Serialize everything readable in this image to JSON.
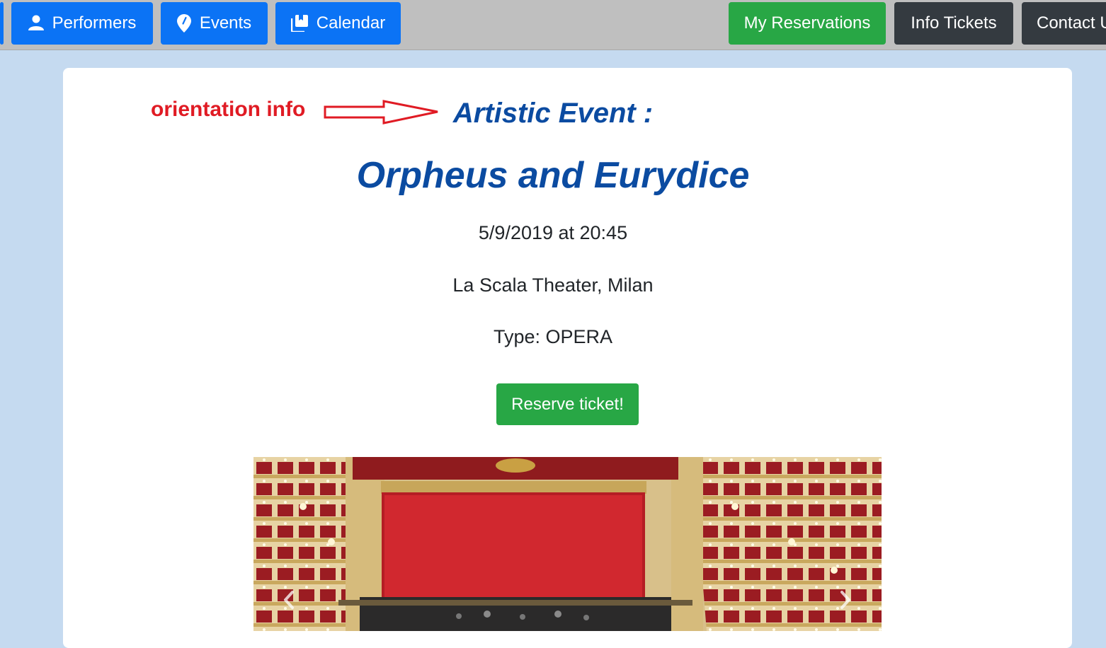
{
  "nav": {
    "left": [
      {
        "label": "Performers",
        "icon": "person-icon"
      },
      {
        "label": "Events",
        "icon": "map-pin-icon"
      },
      {
        "label": "Calendar",
        "icon": "collection-icon"
      }
    ],
    "right": [
      {
        "label": "My Reservations"
      },
      {
        "label": "Info Tickets"
      },
      {
        "label": "Contact Us"
      }
    ]
  },
  "annotation": {
    "label": "orientation info",
    "color": "#e01b24",
    "arrow_icon": "right-arrow-icon"
  },
  "event": {
    "subtitle": "Artistic Event :",
    "title": "Orpheus and Eurydice",
    "datetime": "5/9/2019 at 20:45",
    "venue": "La Scala Theater, Milan",
    "type": "Type: OPERA",
    "reserve_label": "Reserve ticket!"
  },
  "carousel": {
    "prev_icon": "chevron-left-icon",
    "next_icon": "chevron-right-icon"
  },
  "colors": {
    "primary": "#0b73f5",
    "success": "#28a745",
    "dark": "#343a40",
    "heading": "#0b4ba1",
    "page_background": "#c5daf0"
  }
}
